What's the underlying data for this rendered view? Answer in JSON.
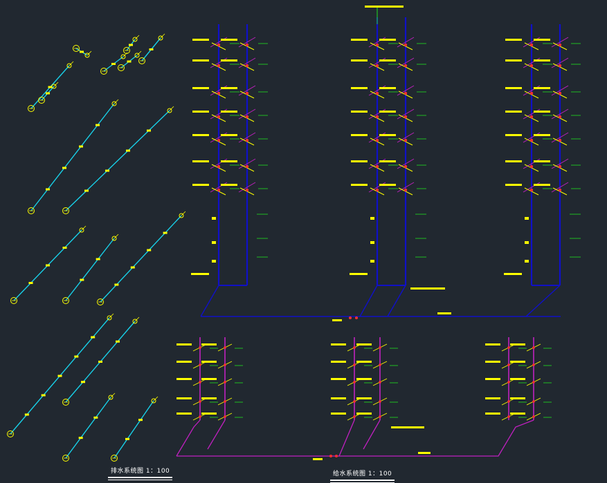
{
  "drawing": {
    "captions": {
      "drainage": "排水系统图 1：100",
      "supply": "给水系统图 1：100"
    },
    "colors": {
      "background": "#212830",
      "drain_pipe": "#18d0e8",
      "supply_riser": "#1010c8",
      "hot_pipe": "#c020c0",
      "label_yellow": "#ffff00",
      "level_green": "#20e020",
      "valve_red": "#ff3030",
      "caption_white": "#ffffff"
    },
    "symbols": [
      "floor-drain-icon",
      "water-meter-icon",
      "gate-valve-icon",
      "elevation-mark-icon",
      "riser-node-icon"
    ]
  }
}
